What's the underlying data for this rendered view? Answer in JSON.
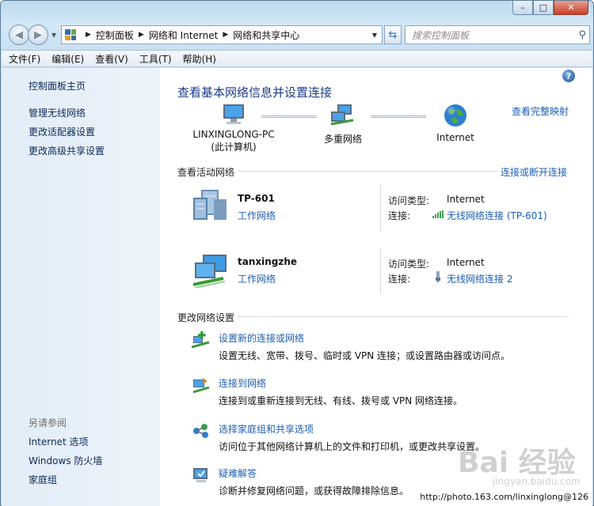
{
  "window": {
    "caption_buttons": {
      "minimize": "–",
      "maximize": "□",
      "close": "✕"
    }
  },
  "address_bar": {
    "crumbs": [
      "控制面板",
      "网络和 Internet",
      "网络和共享中心"
    ],
    "search_placeholder": "搜索控制面板"
  },
  "menu": [
    "文件(F)",
    "编辑(E)",
    "查看(V)",
    "工具(T)",
    "帮助(H)"
  ],
  "sidebar": {
    "home": "控制面板主页",
    "items": [
      "管理无线网络",
      "更改适配器设置",
      "更改高级共享设置"
    ],
    "see_also_title": "另请参阅",
    "see_also": [
      "Internet 选项",
      "Windows 防火墙",
      "家庭组"
    ]
  },
  "main": {
    "title": "查看基本网络信息并设置连接",
    "full_map_link": "查看完整映射",
    "map": {
      "pc_name": "LINXINGLONG-PC",
      "pc_sub": "(此计算机)",
      "middle": "多重网络",
      "internet": "Internet"
    },
    "active_title": "查看活动网络",
    "connect_link": "连接或断开连接",
    "networks": [
      {
        "name": "TP-601",
        "type": "工作网络",
        "access_key": "访问类型:",
        "access_val": "Internet",
        "conn_key": "连接:",
        "conn_val": "无线网络连接 (TP-601)",
        "conn_icon": "wifi-signal-icon"
      },
      {
        "name": "tanxingzhe",
        "type": "工作网络",
        "access_key": "访问类型:",
        "access_val": "Internet",
        "conn_key": "连接:",
        "conn_val": "无线网络连接 2",
        "conn_icon": "wireless-adapter-icon"
      }
    ],
    "change_title": "更改网络设置",
    "tasks": [
      {
        "link": "设置新的连接或网络",
        "desc": "设置无线、宽带、拨号、临时或 VPN 连接；或设置路由器或访问点。"
      },
      {
        "link": "连接到网络",
        "desc": "连接到或重新连接到无线、有线、拨号或 VPN 网络连接。"
      },
      {
        "link": "选择家庭组和共享选项",
        "desc": "访问位于其他网络计算机上的文件和打印机，或更改共享设置。"
      },
      {
        "link": "疑难解答",
        "desc": "诊断并修复网络问题，或获得故障排除信息。"
      }
    ]
  },
  "watermark": {
    "text": "Bai 经验",
    "sub": "jingyan.baidu.com",
    "url": "http://photo.163.com/linxinglong@126"
  },
  "colors": {
    "link": "#1e5fb3",
    "title": "#1b3c8a",
    "sidebar_bg": "#e2edf8"
  }
}
